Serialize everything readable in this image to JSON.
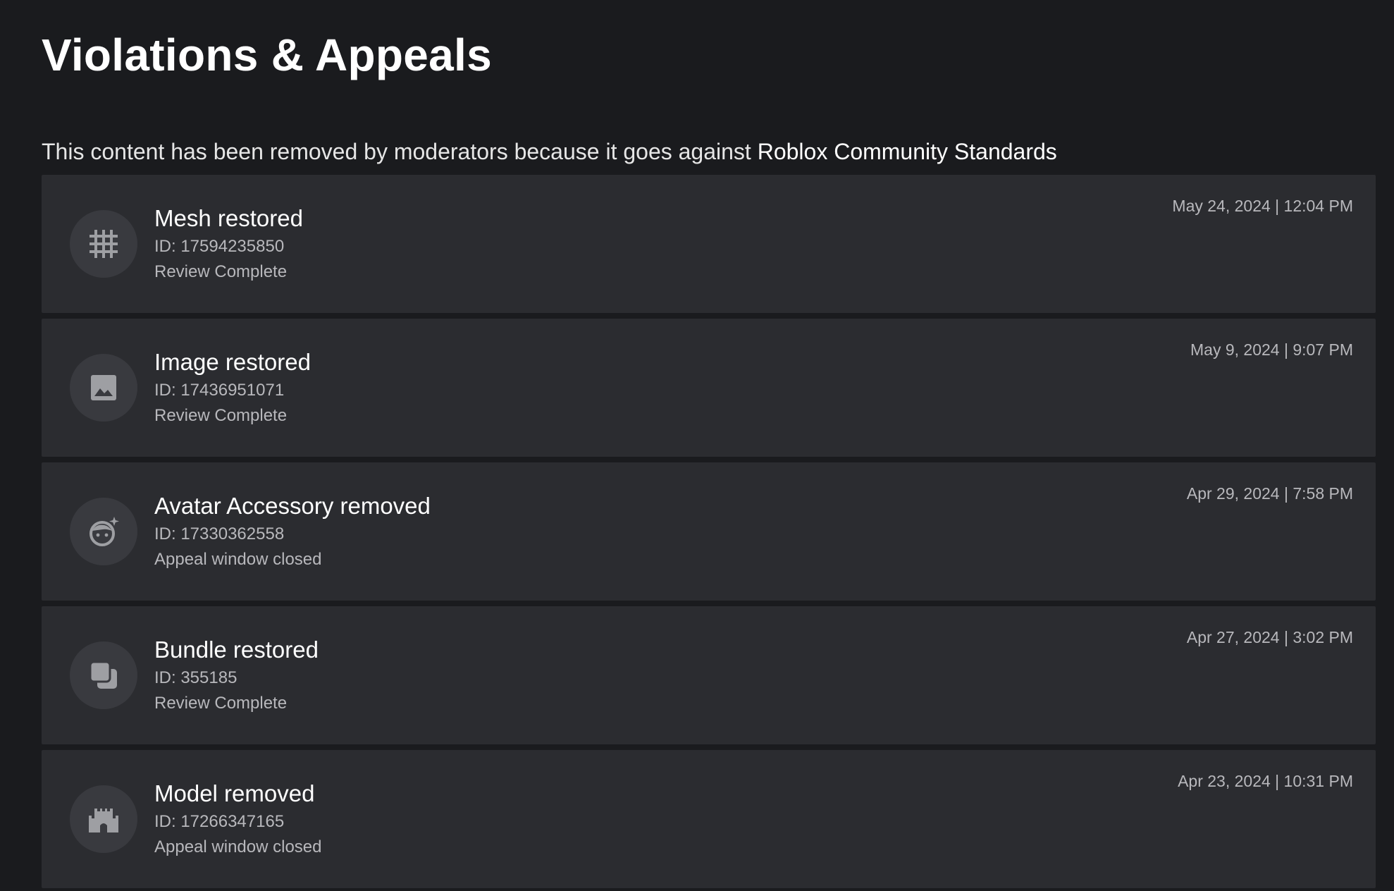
{
  "header": {
    "title": "Violations & Appeals",
    "subtitle_prefix": "This content has been removed by moderators because it goes against ",
    "subtitle_link": "Roblox Community Standards"
  },
  "items": [
    {
      "title": "Mesh restored",
      "id_text": "ID: 17594235850",
      "status": "Review Complete",
      "date": "May 24, 2024 | 12:04 PM",
      "icon": "mesh-grid-icon"
    },
    {
      "title": "Image restored",
      "id_text": "ID: 17436951071",
      "status": "Review Complete",
      "date": "May 9, 2024 | 9:07 PM",
      "icon": "image-icon"
    },
    {
      "title": "Avatar Accessory removed",
      "id_text": "ID: 17330362558",
      "status": "Appeal window closed",
      "date": "Apr 29, 2024 | 7:58 PM",
      "icon": "avatar-face-icon"
    },
    {
      "title": "Bundle restored",
      "id_text": "ID: 355185",
      "status": "Review Complete",
      "date": "Apr 27, 2024 | 3:02 PM",
      "icon": "bundle-icon"
    },
    {
      "title": "Model removed",
      "id_text": "ID: 17266347165",
      "status": "Appeal window closed",
      "date": "Apr 23, 2024 | 10:31 PM",
      "icon": "castle-icon"
    }
  ],
  "colors": {
    "background": "#1a1b1e",
    "card": "#2b2c30",
    "icon_circle": "#393a3f",
    "icon_glyph": "#9e9fa3",
    "secondary_text": "#b8b8bc"
  }
}
